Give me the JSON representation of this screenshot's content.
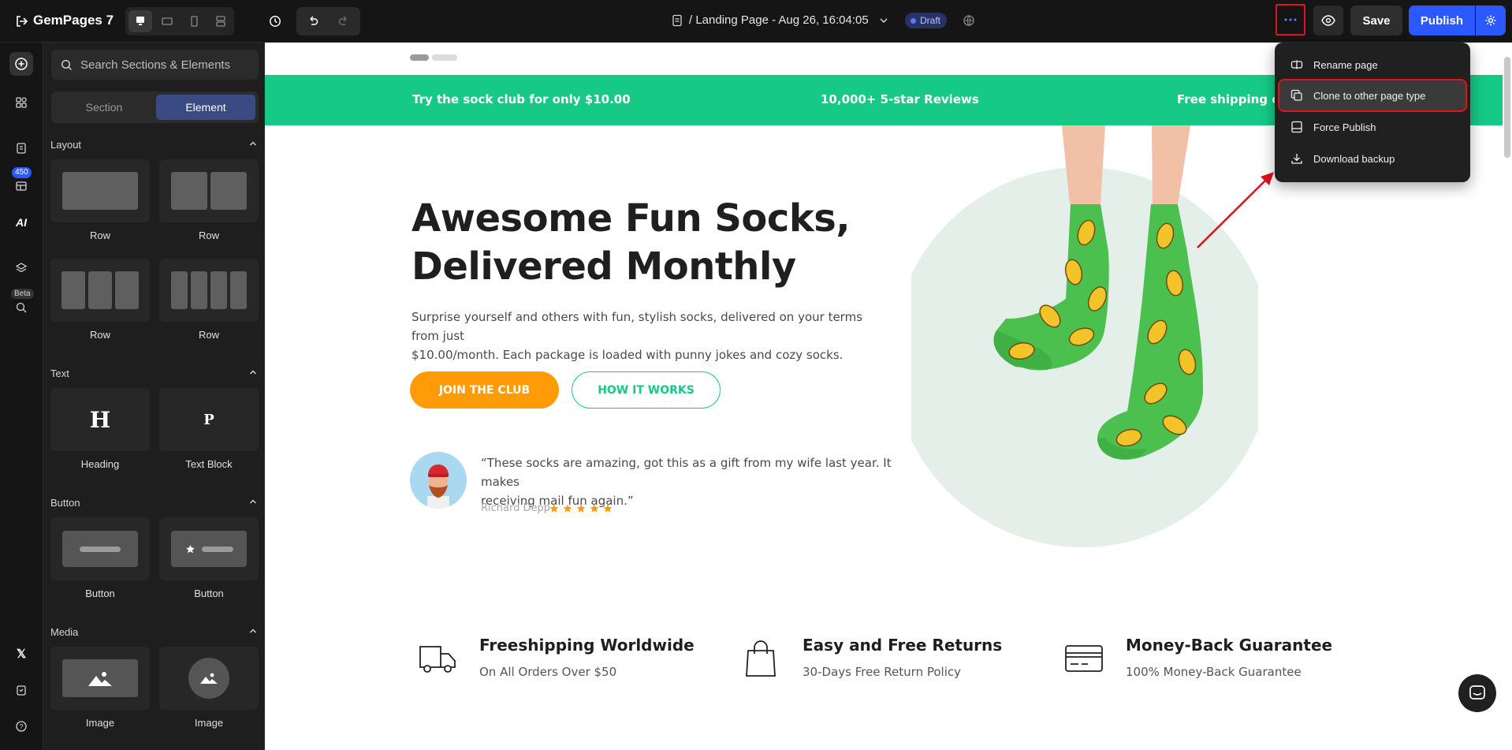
{
  "topbar": {
    "logo": "GemPages 7",
    "page_title": "/ Landing Page - Aug 26, 16:04:05",
    "status_badge": "Draft",
    "save_label": "Save",
    "publish_label": "Publish"
  },
  "rail": {
    "badge_count": "450",
    "beta_label": "Beta"
  },
  "panel": {
    "search_placeholder": "Search Sections & Elements",
    "tabs": [
      "Section",
      "Element"
    ],
    "active_tab": "Element",
    "groups": {
      "layout": {
        "title": "Layout",
        "items": [
          "Row",
          "Row",
          "Row",
          "Row"
        ]
      },
      "text": {
        "title": "Text",
        "items": [
          "Heading",
          "Text Block"
        ]
      },
      "button": {
        "title": "Button",
        "items": [
          "Button",
          "Button"
        ]
      },
      "media": {
        "title": "Media",
        "items": [
          "Image",
          "Image"
        ]
      }
    }
  },
  "canvas": {
    "announcement": [
      "Try the sock club for only $10.00",
      "10,000+ 5-star Reviews",
      "Free shipping on o"
    ],
    "hero": {
      "title_line1": "Awesome Fun Socks,",
      "title_line2": "Delivered Monthly",
      "description_line1": "Surprise yourself and others with fun, stylish socks, delivered on your terms from just",
      "description_line2": "$10.00/month. Each package is loaded with punny jokes and cozy socks.",
      "primary_button": "JOIN THE CLUB",
      "secondary_button": "HOW IT WORKS"
    },
    "testimonial": {
      "quote_line1": "“These socks are amazing, got this as a gift from my wife last year. It makes",
      "quote_line2": "receiving mail fun again.”",
      "author": "Richard Depp",
      "rating": 5
    },
    "features": [
      {
        "title": "Freeshipping Worldwide",
        "subtitle": "On All Orders Over $50",
        "icon": "truck-icon"
      },
      {
        "title": "Easy and Free Returns",
        "subtitle": "30-Days Free Return Policy",
        "icon": "shopping-bag-icon"
      },
      {
        "title": "Money-Back Guarantee",
        "subtitle": "100% Money-Back Guarantee",
        "icon": "credit-card-icon"
      }
    ]
  },
  "menu": {
    "items": [
      "Rename page",
      "Clone to other page type",
      "Force Publish",
      "Download backup"
    ],
    "highlighted": "Clone to other page type"
  },
  "colors": {
    "accent_green": "#16c984",
    "join_orange": "#ff9b06",
    "publish_blue": "#2b58ff",
    "highlight_red": "#e0121b"
  }
}
